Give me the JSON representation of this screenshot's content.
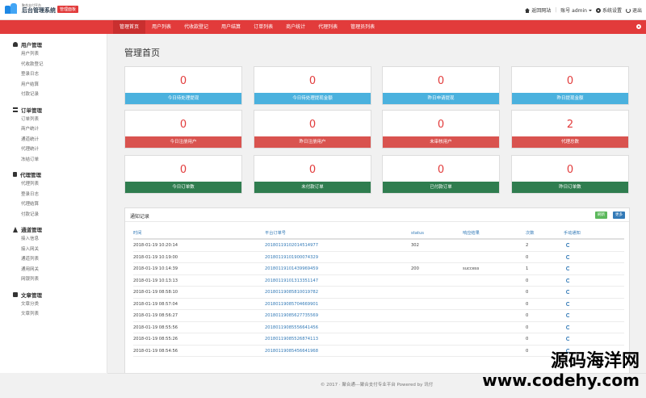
{
  "header": {
    "logo_sub": "聚合支付平台",
    "logo_title": "后台管理系统",
    "version_badge": "管理面板",
    "home_link": "返回网站",
    "account_label": "账号 admin",
    "settings_label": "系统设置",
    "logout_label": "退出"
  },
  "nav": {
    "tabs": [
      "管理首页",
      "用户列表",
      "代收款登记",
      "用户结算",
      "订单列表",
      "商户统计",
      "代理列表",
      "管理员列表"
    ]
  },
  "sidebar": {
    "groups": [
      {
        "title": "用户管理",
        "icon": "user-icon",
        "items": [
          "用户列表",
          "代收款登记",
          "登录日志",
          "用户结算",
          "付款记录"
        ]
      },
      {
        "title": "订单管理",
        "icon": "list-icon",
        "items": [
          "订单列表",
          "商户统计",
          "通道统计",
          "代理统计",
          "冻结订单"
        ]
      },
      {
        "title": "代理管理",
        "icon": "doc-icon",
        "items": [
          "代理列表",
          "登录日志",
          "代理结算",
          "付款记录"
        ]
      },
      {
        "title": "通道管理",
        "icon": "road-icon",
        "items": [
          "接入信息",
          "接入网关",
          "通道列表",
          "通用网关",
          "网银列表"
        ]
      },
      {
        "title": "文章管理",
        "icon": "book-icon",
        "items": [
          "文章分类",
          "文章列表"
        ]
      }
    ]
  },
  "main": {
    "page_title": "管理首页",
    "cards": [
      {
        "value": "0",
        "label": "今日待处理提现",
        "color": "blue"
      },
      {
        "value": "0",
        "label": "今日待处理提现金额",
        "color": "blue"
      },
      {
        "value": "0",
        "label": "昨日申请提现",
        "color": "blue"
      },
      {
        "value": "0",
        "label": "昨日提现金额",
        "color": "blue"
      },
      {
        "value": "0",
        "label": "今日注册用户",
        "color": "red"
      },
      {
        "value": "0",
        "label": "昨日注册用户",
        "color": "red"
      },
      {
        "value": "0",
        "label": "未审核用户",
        "color": "red"
      },
      {
        "value": "2",
        "label": "代理总数",
        "color": "red"
      },
      {
        "value": "0",
        "label": "今日订单数",
        "color": "green"
      },
      {
        "value": "0",
        "label": "未付款订单",
        "color": "green"
      },
      {
        "value": "0",
        "label": "已付款订单",
        "color": "green"
      },
      {
        "value": "0",
        "label": "昨日订单数",
        "color": "green"
      }
    ],
    "notify": {
      "title": "通知记录",
      "refresh_label": "刷新",
      "more_label": "更多",
      "columns": [
        "时间",
        "平台订单号",
        "status",
        "响应结果",
        "次数",
        "手动通知"
      ],
      "rows": [
        [
          "2018-01-19 10:20:14",
          "20180119102014514977",
          "302",
          "",
          "2"
        ],
        [
          "2018-01-19 10:19:00",
          "20180119101900074329",
          "",
          "",
          "0"
        ],
        [
          "2018-01-19 10:14:39",
          "20180119101439969459",
          "200",
          "success",
          "1"
        ],
        [
          "2018-01-19 10:13:13",
          "20180119101313351147",
          "",
          "",
          "0"
        ],
        [
          "2018-01-19 08:58:10",
          "20180119085810019782",
          "",
          "",
          "0"
        ],
        [
          "2018-01-19 08:57:04",
          "20180119085704669901",
          "",
          "",
          "0"
        ],
        [
          "2018-01-19 08:56:27",
          "20180119085627735569",
          "",
          "",
          "0"
        ],
        [
          "2018-01-19 08:55:56",
          "20180119085556641456",
          "",
          "",
          "0"
        ],
        [
          "2018-01-19 08:55:26",
          "20180119085526874113",
          "",
          "",
          "0"
        ],
        [
          "2018-01-19 08:54:56",
          "20180119085456641968",
          "",
          "",
          "0"
        ]
      ]
    }
  },
  "footer": {
    "text": "© 2017 · 聚合通---聚合支付专业平台 Powered by 讯付"
  },
  "watermark": {
    "cn": "源码海洋网",
    "url": "www.codehy.com"
  },
  "colors": {
    "accent_red": "#e23b3b",
    "blue": "#4ab1de",
    "red": "#d9534f",
    "green": "#2f7d4f"
  }
}
